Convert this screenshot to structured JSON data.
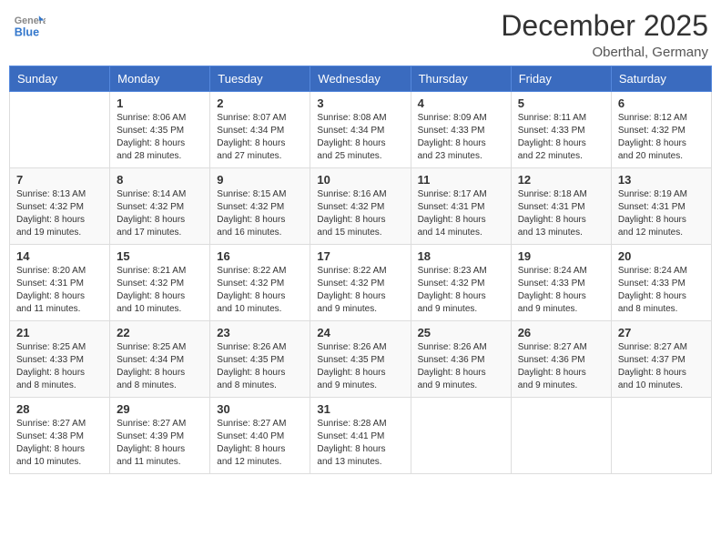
{
  "logo": {
    "text_general": "General",
    "text_blue": "Blue"
  },
  "header": {
    "month": "December 2025",
    "location": "Oberthal, Germany"
  },
  "weekdays": [
    "Sunday",
    "Monday",
    "Tuesday",
    "Wednesday",
    "Thursday",
    "Friday",
    "Saturday"
  ],
  "weeks": [
    [
      {
        "day": "",
        "info": ""
      },
      {
        "day": "1",
        "info": "Sunrise: 8:06 AM\nSunset: 4:35 PM\nDaylight: 8 hours\nand 28 minutes."
      },
      {
        "day": "2",
        "info": "Sunrise: 8:07 AM\nSunset: 4:34 PM\nDaylight: 8 hours\nand 27 minutes."
      },
      {
        "day": "3",
        "info": "Sunrise: 8:08 AM\nSunset: 4:34 PM\nDaylight: 8 hours\nand 25 minutes."
      },
      {
        "day": "4",
        "info": "Sunrise: 8:09 AM\nSunset: 4:33 PM\nDaylight: 8 hours\nand 23 minutes."
      },
      {
        "day": "5",
        "info": "Sunrise: 8:11 AM\nSunset: 4:33 PM\nDaylight: 8 hours\nand 22 minutes."
      },
      {
        "day": "6",
        "info": "Sunrise: 8:12 AM\nSunset: 4:32 PM\nDaylight: 8 hours\nand 20 minutes."
      }
    ],
    [
      {
        "day": "7",
        "info": "Sunrise: 8:13 AM\nSunset: 4:32 PM\nDaylight: 8 hours\nand 19 minutes."
      },
      {
        "day": "8",
        "info": "Sunrise: 8:14 AM\nSunset: 4:32 PM\nDaylight: 8 hours\nand 17 minutes."
      },
      {
        "day": "9",
        "info": "Sunrise: 8:15 AM\nSunset: 4:32 PM\nDaylight: 8 hours\nand 16 minutes."
      },
      {
        "day": "10",
        "info": "Sunrise: 8:16 AM\nSunset: 4:32 PM\nDaylight: 8 hours\nand 15 minutes."
      },
      {
        "day": "11",
        "info": "Sunrise: 8:17 AM\nSunset: 4:31 PM\nDaylight: 8 hours\nand 14 minutes."
      },
      {
        "day": "12",
        "info": "Sunrise: 8:18 AM\nSunset: 4:31 PM\nDaylight: 8 hours\nand 13 minutes."
      },
      {
        "day": "13",
        "info": "Sunrise: 8:19 AM\nSunset: 4:31 PM\nDaylight: 8 hours\nand 12 minutes."
      }
    ],
    [
      {
        "day": "14",
        "info": "Sunrise: 8:20 AM\nSunset: 4:31 PM\nDaylight: 8 hours\nand 11 minutes."
      },
      {
        "day": "15",
        "info": "Sunrise: 8:21 AM\nSunset: 4:32 PM\nDaylight: 8 hours\nand 10 minutes."
      },
      {
        "day": "16",
        "info": "Sunrise: 8:22 AM\nSunset: 4:32 PM\nDaylight: 8 hours\nand 10 minutes."
      },
      {
        "day": "17",
        "info": "Sunrise: 8:22 AM\nSunset: 4:32 PM\nDaylight: 8 hours\nand 9 minutes."
      },
      {
        "day": "18",
        "info": "Sunrise: 8:23 AM\nSunset: 4:32 PM\nDaylight: 8 hours\nand 9 minutes."
      },
      {
        "day": "19",
        "info": "Sunrise: 8:24 AM\nSunset: 4:33 PM\nDaylight: 8 hours\nand 9 minutes."
      },
      {
        "day": "20",
        "info": "Sunrise: 8:24 AM\nSunset: 4:33 PM\nDaylight: 8 hours\nand 8 minutes."
      }
    ],
    [
      {
        "day": "21",
        "info": "Sunrise: 8:25 AM\nSunset: 4:33 PM\nDaylight: 8 hours\nand 8 minutes."
      },
      {
        "day": "22",
        "info": "Sunrise: 8:25 AM\nSunset: 4:34 PM\nDaylight: 8 hours\nand 8 minutes."
      },
      {
        "day": "23",
        "info": "Sunrise: 8:26 AM\nSunset: 4:35 PM\nDaylight: 8 hours\nand 8 minutes."
      },
      {
        "day": "24",
        "info": "Sunrise: 8:26 AM\nSunset: 4:35 PM\nDaylight: 8 hours\nand 9 minutes."
      },
      {
        "day": "25",
        "info": "Sunrise: 8:26 AM\nSunset: 4:36 PM\nDaylight: 8 hours\nand 9 minutes."
      },
      {
        "day": "26",
        "info": "Sunrise: 8:27 AM\nSunset: 4:36 PM\nDaylight: 8 hours\nand 9 minutes."
      },
      {
        "day": "27",
        "info": "Sunrise: 8:27 AM\nSunset: 4:37 PM\nDaylight: 8 hours\nand 10 minutes."
      }
    ],
    [
      {
        "day": "28",
        "info": "Sunrise: 8:27 AM\nSunset: 4:38 PM\nDaylight: 8 hours\nand 10 minutes."
      },
      {
        "day": "29",
        "info": "Sunrise: 8:27 AM\nSunset: 4:39 PM\nDaylight: 8 hours\nand 11 minutes."
      },
      {
        "day": "30",
        "info": "Sunrise: 8:27 AM\nSunset: 4:40 PM\nDaylight: 8 hours\nand 12 minutes."
      },
      {
        "day": "31",
        "info": "Sunrise: 8:28 AM\nSunset: 4:41 PM\nDaylight: 8 hours\nand 13 minutes."
      },
      {
        "day": "",
        "info": ""
      },
      {
        "day": "",
        "info": ""
      },
      {
        "day": "",
        "info": ""
      }
    ]
  ]
}
